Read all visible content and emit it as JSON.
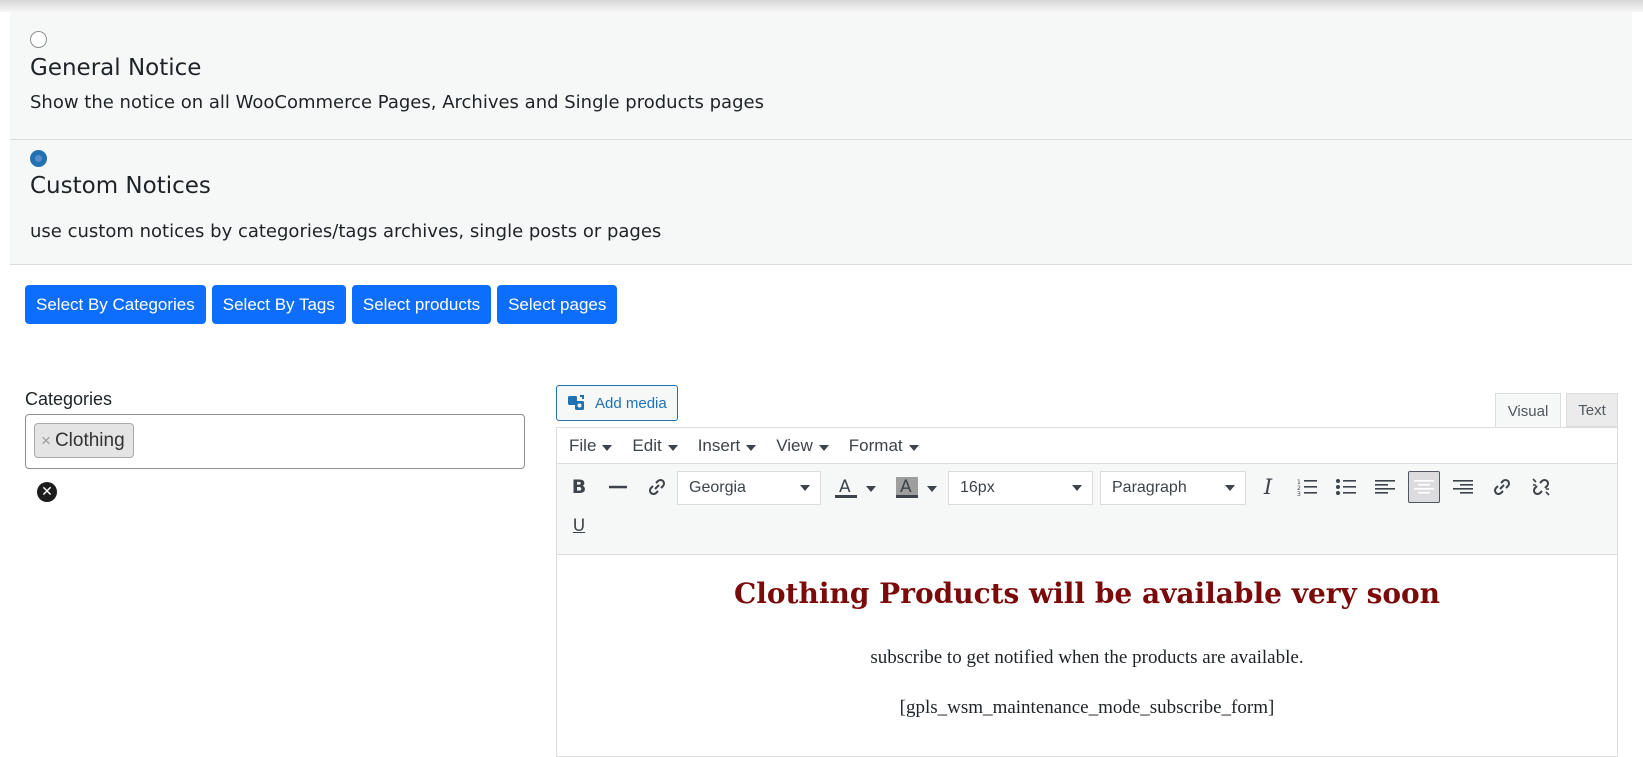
{
  "options": {
    "general": {
      "title": "General Notice",
      "description": "Show the notice on all WooCommerce Pages, Archives and Single products pages",
      "selected": false
    },
    "custom": {
      "title": "Custom Notices",
      "description": "use custom notices by categories/tags archives, single posts or pages",
      "selected": true
    }
  },
  "select_buttons": {
    "categories": "Select By Categories",
    "tags": "Select By Tags",
    "products": "Select products",
    "pages": "Select pages"
  },
  "categories_field": {
    "label": "Categories",
    "chip_remove": "×",
    "chip_label": "Clothing"
  },
  "editor": {
    "add_media": "Add media",
    "tabs": {
      "visual": "Visual",
      "text": "Text"
    },
    "menu": {
      "file": "File",
      "edit": "Edit",
      "insert": "Insert",
      "view": "View",
      "format": "Format"
    },
    "font_family": "Georgia",
    "font_size": "16px",
    "block_format": "Paragraph",
    "content": {
      "heading": "Clothing Products will be available very soon",
      "subtext": "subscribe to get notified when the products are available.",
      "shortcode": "[gpls_wsm_maintenance_mode_subscribe_form]"
    }
  },
  "colors": {
    "primary_button": "#0d6efd",
    "heading_text": "#7b0a0a",
    "radio_selected": "#2271b1"
  }
}
